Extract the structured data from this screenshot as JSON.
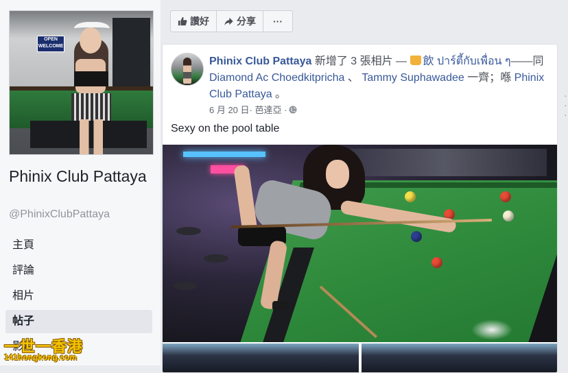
{
  "page": {
    "name": "Phinix Club Pattaya",
    "handle": "@PhinixClubPattaya",
    "cover_sign": "OPEN\nWELCOME"
  },
  "nav": {
    "items": [
      {
        "label": "主頁"
      },
      {
        "label": "評論"
      },
      {
        "label": "相片"
      },
      {
        "label": "帖子",
        "active": true
      },
      {
        "label": "影片"
      }
    ]
  },
  "actions": {
    "like_label": "讚好",
    "share_label": "分享",
    "more_label": "···"
  },
  "post": {
    "author": "Phinix Club Pattaya",
    "verb": " 新增了 3 張相片 — ",
    "feeling": "飲 ปาร์ตี้กับเพื่อน ๆ",
    "with": "——同 ",
    "friend1": "Diamond Ac Choedkitpricha",
    "sep": " 、 ",
    "friend2": "Tammy Suphawadee",
    "together": " 一齊；喺 ",
    "location": "Phinix Club Pattaya",
    "end": " 。",
    "date": "6 月 20 日",
    "place": " · 芭達亞 · ",
    "caption": "Sexy on the pool table",
    "ball_colors": [
      "#f6e04a",
      "#e94b35",
      "#e94b35",
      "#f4eed2",
      "#2b3f8e",
      "#e94b35"
    ]
  },
  "watermark": {
    "line1": "一世一香港",
    "line2": "141hongkong.com"
  },
  "colors": {
    "link": "#385898",
    "background": "#e9ebee",
    "card": "#ffffff"
  }
}
